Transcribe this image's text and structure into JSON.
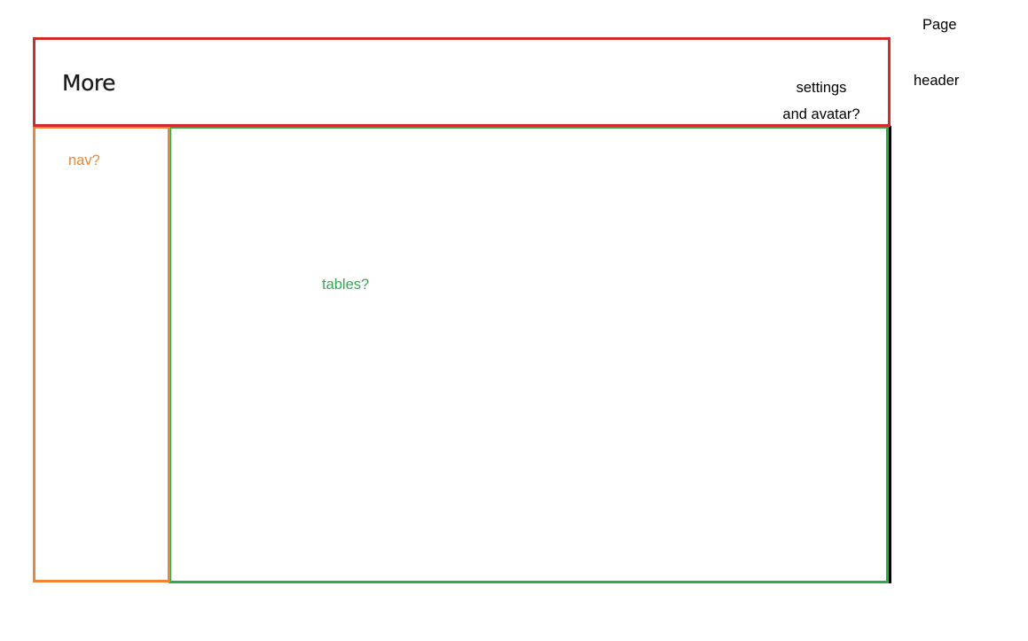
{
  "annotations": {
    "page_label": "Page",
    "header_label": "header"
  },
  "header": {
    "title": "More",
    "hint_line1": "settings",
    "hint_line2": "and avatar?"
  },
  "nav": {
    "hint": "nav?"
  },
  "main": {
    "hint": "tables?"
  },
  "colors": {
    "header_border": "#d42a2a",
    "nav_border": "#ef8532",
    "main_border": "#2eac4c",
    "frame": "#000000"
  }
}
